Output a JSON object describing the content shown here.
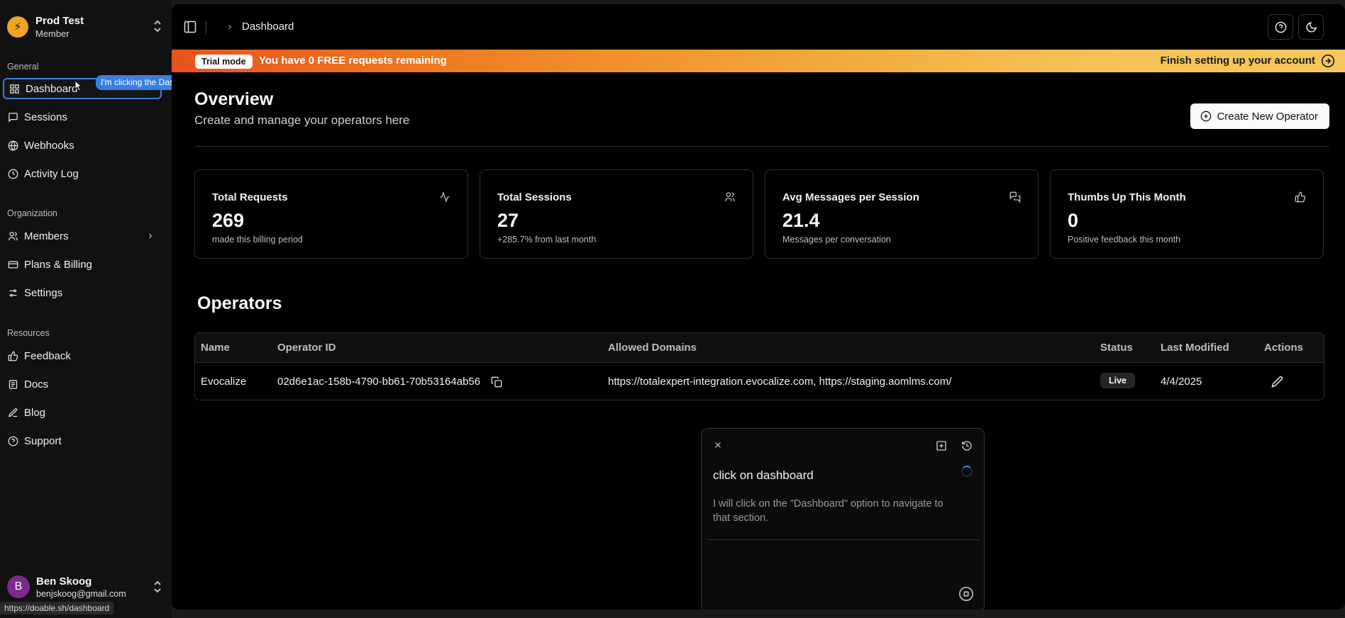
{
  "org": {
    "initial": "⚡",
    "name": "Prod Test",
    "role": "Member"
  },
  "sidebar": {
    "general_label": "General",
    "general_items": [
      {
        "label": "Dashboard",
        "icon": "layout-grid-icon"
      },
      {
        "label": "Sessions",
        "icon": "message-square-icon"
      },
      {
        "label": "Webhooks",
        "icon": "globe-icon"
      },
      {
        "label": "Activity Log",
        "icon": "clock-icon"
      }
    ],
    "organization_label": "Organization",
    "organization_items": [
      {
        "label": "Members",
        "icon": "users-icon"
      },
      {
        "label": "Plans & Billing",
        "icon": "wallet-icon"
      },
      {
        "label": "Settings",
        "icon": "sliders-icon"
      }
    ],
    "resources_label": "Resources",
    "resources_items": [
      {
        "label": "Feedback",
        "icon": "thumbs-up-icon"
      },
      {
        "label": "Docs",
        "icon": "book-icon"
      },
      {
        "label": "Blog",
        "icon": "pen-icon"
      },
      {
        "label": "Support",
        "icon": "help-circle-icon"
      }
    ]
  },
  "tooltip": "I'm clicking the Dashboard",
  "user": {
    "initial": "B",
    "name": "Ben Skoog",
    "email": "benjskoog@gmail.com"
  },
  "status_url": "https://doable.sh/dashboard",
  "header": {
    "breadcrumb": "Dashboard"
  },
  "banner": {
    "badge": "Trial mode",
    "message": "You have 0 FREE requests remaining",
    "cta": "Finish setting up your account"
  },
  "overview": {
    "title": "Overview",
    "subtitle": "Create and manage your operators here",
    "create_button": "Create New Operator"
  },
  "stats": [
    {
      "title": "Total Requests",
      "value": "269",
      "caption": "made this billing period",
      "icon": "activity-icon"
    },
    {
      "title": "Total Sessions",
      "value": "27",
      "caption": "+285.7% from last month",
      "icon": "users-icon"
    },
    {
      "title": "Avg Messages per Session",
      "value": "21.4",
      "caption": "Messages per conversation",
      "icon": "messages-icon"
    },
    {
      "title": "Thumbs Up This Month",
      "value": "0",
      "caption": "Positive feedback this month",
      "icon": "thumbs-up-icon"
    }
  ],
  "operators": {
    "title": "Operators",
    "columns": [
      "Name",
      "Operator ID",
      "Allowed Domains",
      "Status",
      "Last Modified",
      "Actions"
    ],
    "rows": [
      {
        "name": "Evocalize",
        "id": "02d6e1ac-158b-4790-bb61-70b53164ab56",
        "domains": "https://totalexpert-integration.evocalize.com, https://staging.aomlms.com/",
        "status": "Live",
        "last_modified": "4/4/2025"
      }
    ]
  },
  "agent": {
    "prompt": "click on dashboard",
    "response": "I will click on the \"Dashboard\" option to navigate to that section."
  }
}
